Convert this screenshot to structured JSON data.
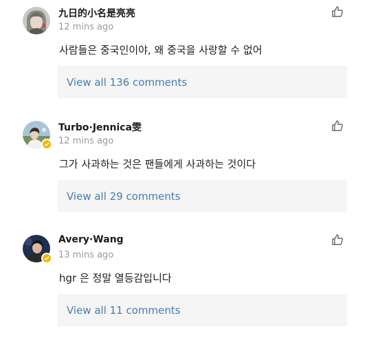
{
  "comments": [
    {
      "username": "九日的小名是亮亮",
      "time": "12 mins ago",
      "text": "사람들은 중국인이야, 왜 중국을 사랑할 수 없어",
      "replies_label": "View all 136 comments",
      "verified": false,
      "icons": {
        "like": "thumbs-up-icon"
      }
    },
    {
      "username": "Turbo·Jennica雯",
      "time": "12 mins ago",
      "text": "그가 사과하는 것은 팬들에게 사과하는 것이다",
      "replies_label": "View all 29 comments",
      "verified": true,
      "icons": {
        "like": "thumbs-up-icon"
      }
    },
    {
      "username": "Avery·Wang",
      "time": "13 mins ago",
      "text": "hgr 은 정말 열등감입니다",
      "replies_label": "View all 11 comments",
      "verified": true,
      "icons": {
        "like": "thumbs-up-icon"
      }
    }
  ],
  "colors": {
    "link": "#4a7bab",
    "timestamp": "#9a9a9a",
    "replies_background": "#f5f5f5",
    "verified_badge": "#f2b705"
  }
}
